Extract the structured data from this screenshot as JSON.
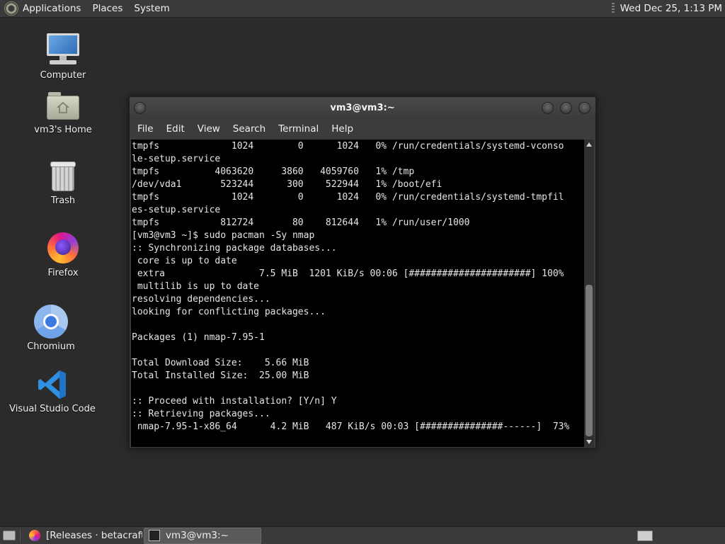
{
  "top_panel": {
    "menus": [
      "Applications",
      "Places",
      "System"
    ],
    "clock": "Wed Dec 25, 1:13 PM"
  },
  "desktop": {
    "icons": [
      {
        "label": "Computer",
        "icon": "computer-icon"
      },
      {
        "label": "vm3's Home",
        "icon": "home-folder-icon"
      },
      {
        "label": "Trash",
        "icon": "trash-icon"
      },
      {
        "label": "Firefox",
        "icon": "firefox-icon"
      },
      {
        "label": "Chromium",
        "icon": "chromium-icon"
      },
      {
        "label": "Visual Studio Code",
        "icon": "vscode-icon"
      }
    ]
  },
  "terminal": {
    "title": "vm3@vm3:~",
    "menus": [
      "File",
      "Edit",
      "View",
      "Search",
      "Terminal",
      "Help"
    ],
    "output": "tmpfs             1024        0      1024   0% /run/credentials/systemd-vconso\nle-setup.service\ntmpfs          4063620     3860   4059760   1% /tmp\n/dev/vda1       523244      300    522944   1% /boot/efi\ntmpfs             1024        0      1024   0% /run/credentials/systemd-tmpfil\nes-setup.service\ntmpfs           812724       80    812644   1% /run/user/1000\n[vm3@vm3 ~]$ sudo pacman -Sy nmap\n:: Synchronizing package databases...\n core is up to date\n extra                 7.5 MiB  1201 KiB/s 00:06 [######################] 100%\n multilib is up to date\nresolving dependencies...\nlooking for conflicting packages...\n\nPackages (1) nmap-7.95-1\n\nTotal Download Size:    5.66 MiB\nTotal Installed Size:  25.00 MiB\n\n:: Proceed with installation? [Y/n] Y\n:: Retrieving packages...\n nmap-7.95-1-x86_64      4.2 MiB   487 KiB/s 00:03 [###############------]  73%"
  },
  "taskbar": {
    "tasks": [
      {
        "label": "[Releases · betacraft...",
        "icon": "firefox-icon",
        "active": false
      },
      {
        "label": "vm3@vm3:~",
        "icon": "terminal-icon",
        "active": true
      }
    ]
  }
}
